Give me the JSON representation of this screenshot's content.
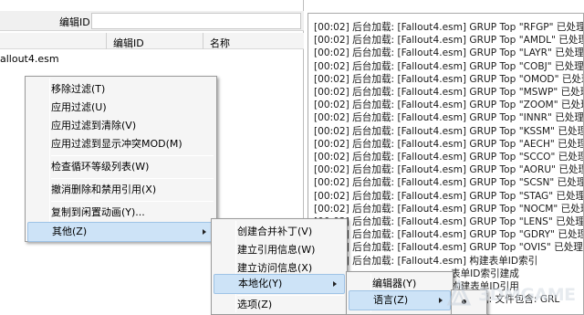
{
  "filter_bar": {
    "label": "编辑ID"
  },
  "columns": {
    "editor_id": "编辑ID",
    "name": "名称"
  },
  "tree": {
    "file": "allout4.esm"
  },
  "log": [
    "[00:02] 后台加载: [Fallout4.esm] GRUP Top \"RFGP\" 已处理",
    "[00:02] 后台加载: [Fallout4.esm] GRUP Top \"AMDL\" 已处理",
    "[00:02] 后台加载: [Fallout4.esm] GRUP Top \"LAYR\" 已处理",
    "[00:02] 后台加载: [Fallout4.esm] GRUP Top \"COBJ\" 已处理",
    "[00:02] 后台加载: [Fallout4.esm] GRUP Top \"OMOD\" 已处理",
    "[00:02] 后台加载: [Fallout4.esm] GRUP Top \"MSWP\" 已处理",
    "[00:02] 后台加载: [Fallout4.esm] GRUP Top \"ZOOM\" 已处理",
    "[00:02] 后台加载: [Fallout4.esm] GRUP Top \"INNR\" 已处理",
    "[00:02] 后台加载: [Fallout4.esm] GRUP Top \"KSSM\" 已处理",
    "[00:02] 后台加载: [Fallout4.esm] GRUP Top \"AECH\" 已处理",
    "[00:02] 后台加载: [Fallout4.esm] GRUP Top \"SCCO\" 已处理",
    "[00:02] 后台加载: [Fallout4.esm] GRUP Top \"AORU\" 已处理",
    "[00:02] 后台加载: [Fallout4.esm] GRUP Top \"SCSN\" 已处理",
    "[00:02] 后台加载: [Fallout4.esm] GRUP Top \"STAG\" 已处理",
    "[00:02] 后台加载: [Fallout4.esm] GRUP Top \"NOCM\" 已处理",
    "[00:02] 后台加载: [Fallout4.esm] GRUP Top \"LENS\" 已处理",
    "[00:02] 后台加载: [Fallout4.esm] GRUP Top \"GDRY\" 已处理",
    "[00:02] 后台加载: [Fallout4.esm] GRUP Top \"OVIS\" 已处理",
    "[00:02] 后台加载: [Fallout4.esm] 构建表单ID索引",
    "表单ID索引建成",
    "构建表单ID引用",
    "[00:02] 后台加载: [Fallout4.esm] 完成: 文件包含: GRL"
  ],
  "context_menu": {
    "items": [
      "移除过滤(T)",
      "应用过滤(U)",
      "应用过滤到清除(V)",
      "应用过滤到显示冲突MOD(M)",
      "检查循环等级列表(W)",
      "撤消删除和禁用引用(X)",
      "复制到闲置动画(Y)...",
      "其他(Z)"
    ]
  },
  "submenu_other": {
    "items": [
      "创建合并补丁(V)",
      "建立引用信息(W)",
      "建立访问信息(X)",
      "本地化(Y)",
      "选项(Z)"
    ]
  },
  "submenu_localization": {
    "items": [
      "编辑器(Y)",
      "语言(Z)"
    ]
  },
  "watermark": {
    "text": "3DMGAME"
  }
}
